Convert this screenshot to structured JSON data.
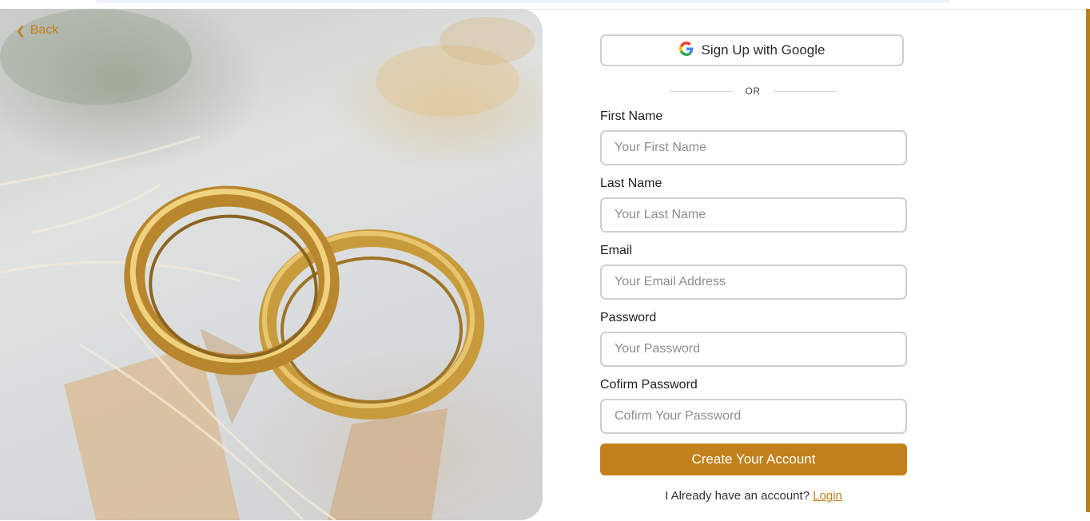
{
  "back": {
    "label": "Back",
    "icon": "chevron-left-icon"
  },
  "google": {
    "label": "Sign Up with Google",
    "icon": "google-icon"
  },
  "divider": {
    "text": "OR"
  },
  "fields": [
    {
      "label": "First Name",
      "placeholder": "Your First Name",
      "value": ""
    },
    {
      "label": "Last Name",
      "placeholder": "Your Last Name",
      "value": ""
    },
    {
      "label": "Email",
      "placeholder": "Your Email Address",
      "value": ""
    },
    {
      "label": "Password",
      "placeholder": "Your Password",
      "value": ""
    },
    {
      "label": "Cofirm Password",
      "placeholder": "Cofirm Your Password",
      "value": ""
    }
  ],
  "submit": {
    "label": "Create Your Account"
  },
  "login_prompt": {
    "text": "I Already have an account?",
    "link": "Login"
  },
  "colors": {
    "accent": "#c1801a",
    "border": "#cfcfcf"
  }
}
